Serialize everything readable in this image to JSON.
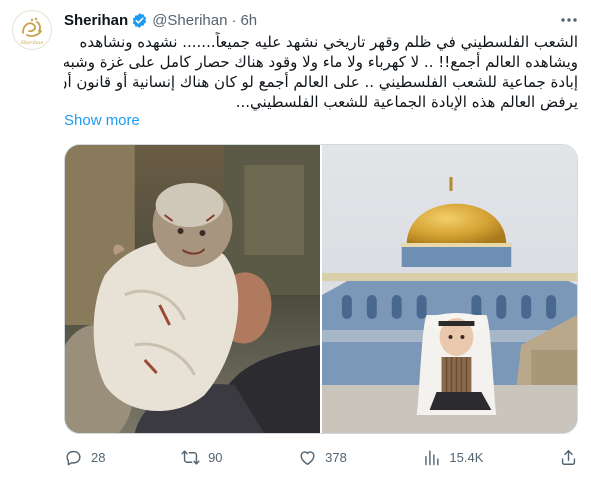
{
  "author": {
    "display_name": "Sherihan",
    "handle": "@Sherihan",
    "separator": "·",
    "time": "6h",
    "avatar_text": "Sherihan"
  },
  "tweet": {
    "lines": [
      "الشعب الفلسطيني في ظلم وقهر تاريخي نشهد عليه جميعاً....... نشهده ونشاهده",
      "ويشاهده العالم أجمع!! .. لا كهرباء ولا ماء ولا وقود هناك حصار كامل على غزة وشبه",
      "إبادة جماعية للشعب الفلسطيني .. على العالم أجمع لو كان هناك إنسانية أو قانون أن",
      "يرفض  العالم هذه الإبادة الجماعية للشعب الفلسطيني..."
    ],
    "show_more": "Show more"
  },
  "actions": {
    "replies": "28",
    "reposts": "90",
    "likes": "378",
    "views": "15.4K"
  },
  "colors": {
    "accent": "#1d9bf0",
    "muted": "#536471",
    "text": "#0f1419",
    "border": "#cfd9de"
  }
}
